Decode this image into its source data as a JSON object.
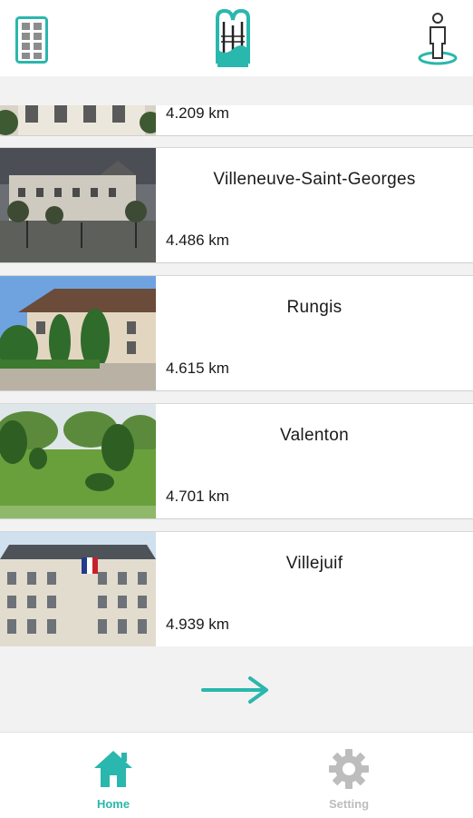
{
  "colors": {
    "accent": "#2ab7ad",
    "inactive": "#bdbdbd",
    "background": "#f2f2f2"
  },
  "header": {
    "menu_icon": "grid-menu-icon",
    "logo_icon": "app-logo-icon",
    "profile_icon": "person-pin-icon"
  },
  "places": [
    {
      "name": "",
      "distance": "4.209 km"
    },
    {
      "name": "Villeneuve-Saint-Georges",
      "distance": "4.486 km"
    },
    {
      "name": "Rungis",
      "distance": "4.615 km"
    },
    {
      "name": "Valenton",
      "distance": "4.701 km"
    },
    {
      "name": "Villejuif",
      "distance": "4.939 km"
    }
  ],
  "next_icon": "arrow-right-icon",
  "bottom_nav": [
    {
      "label": "Home",
      "icon": "home-icon",
      "active": true
    },
    {
      "label": "Setting",
      "icon": "gear-icon",
      "active": false
    }
  ]
}
